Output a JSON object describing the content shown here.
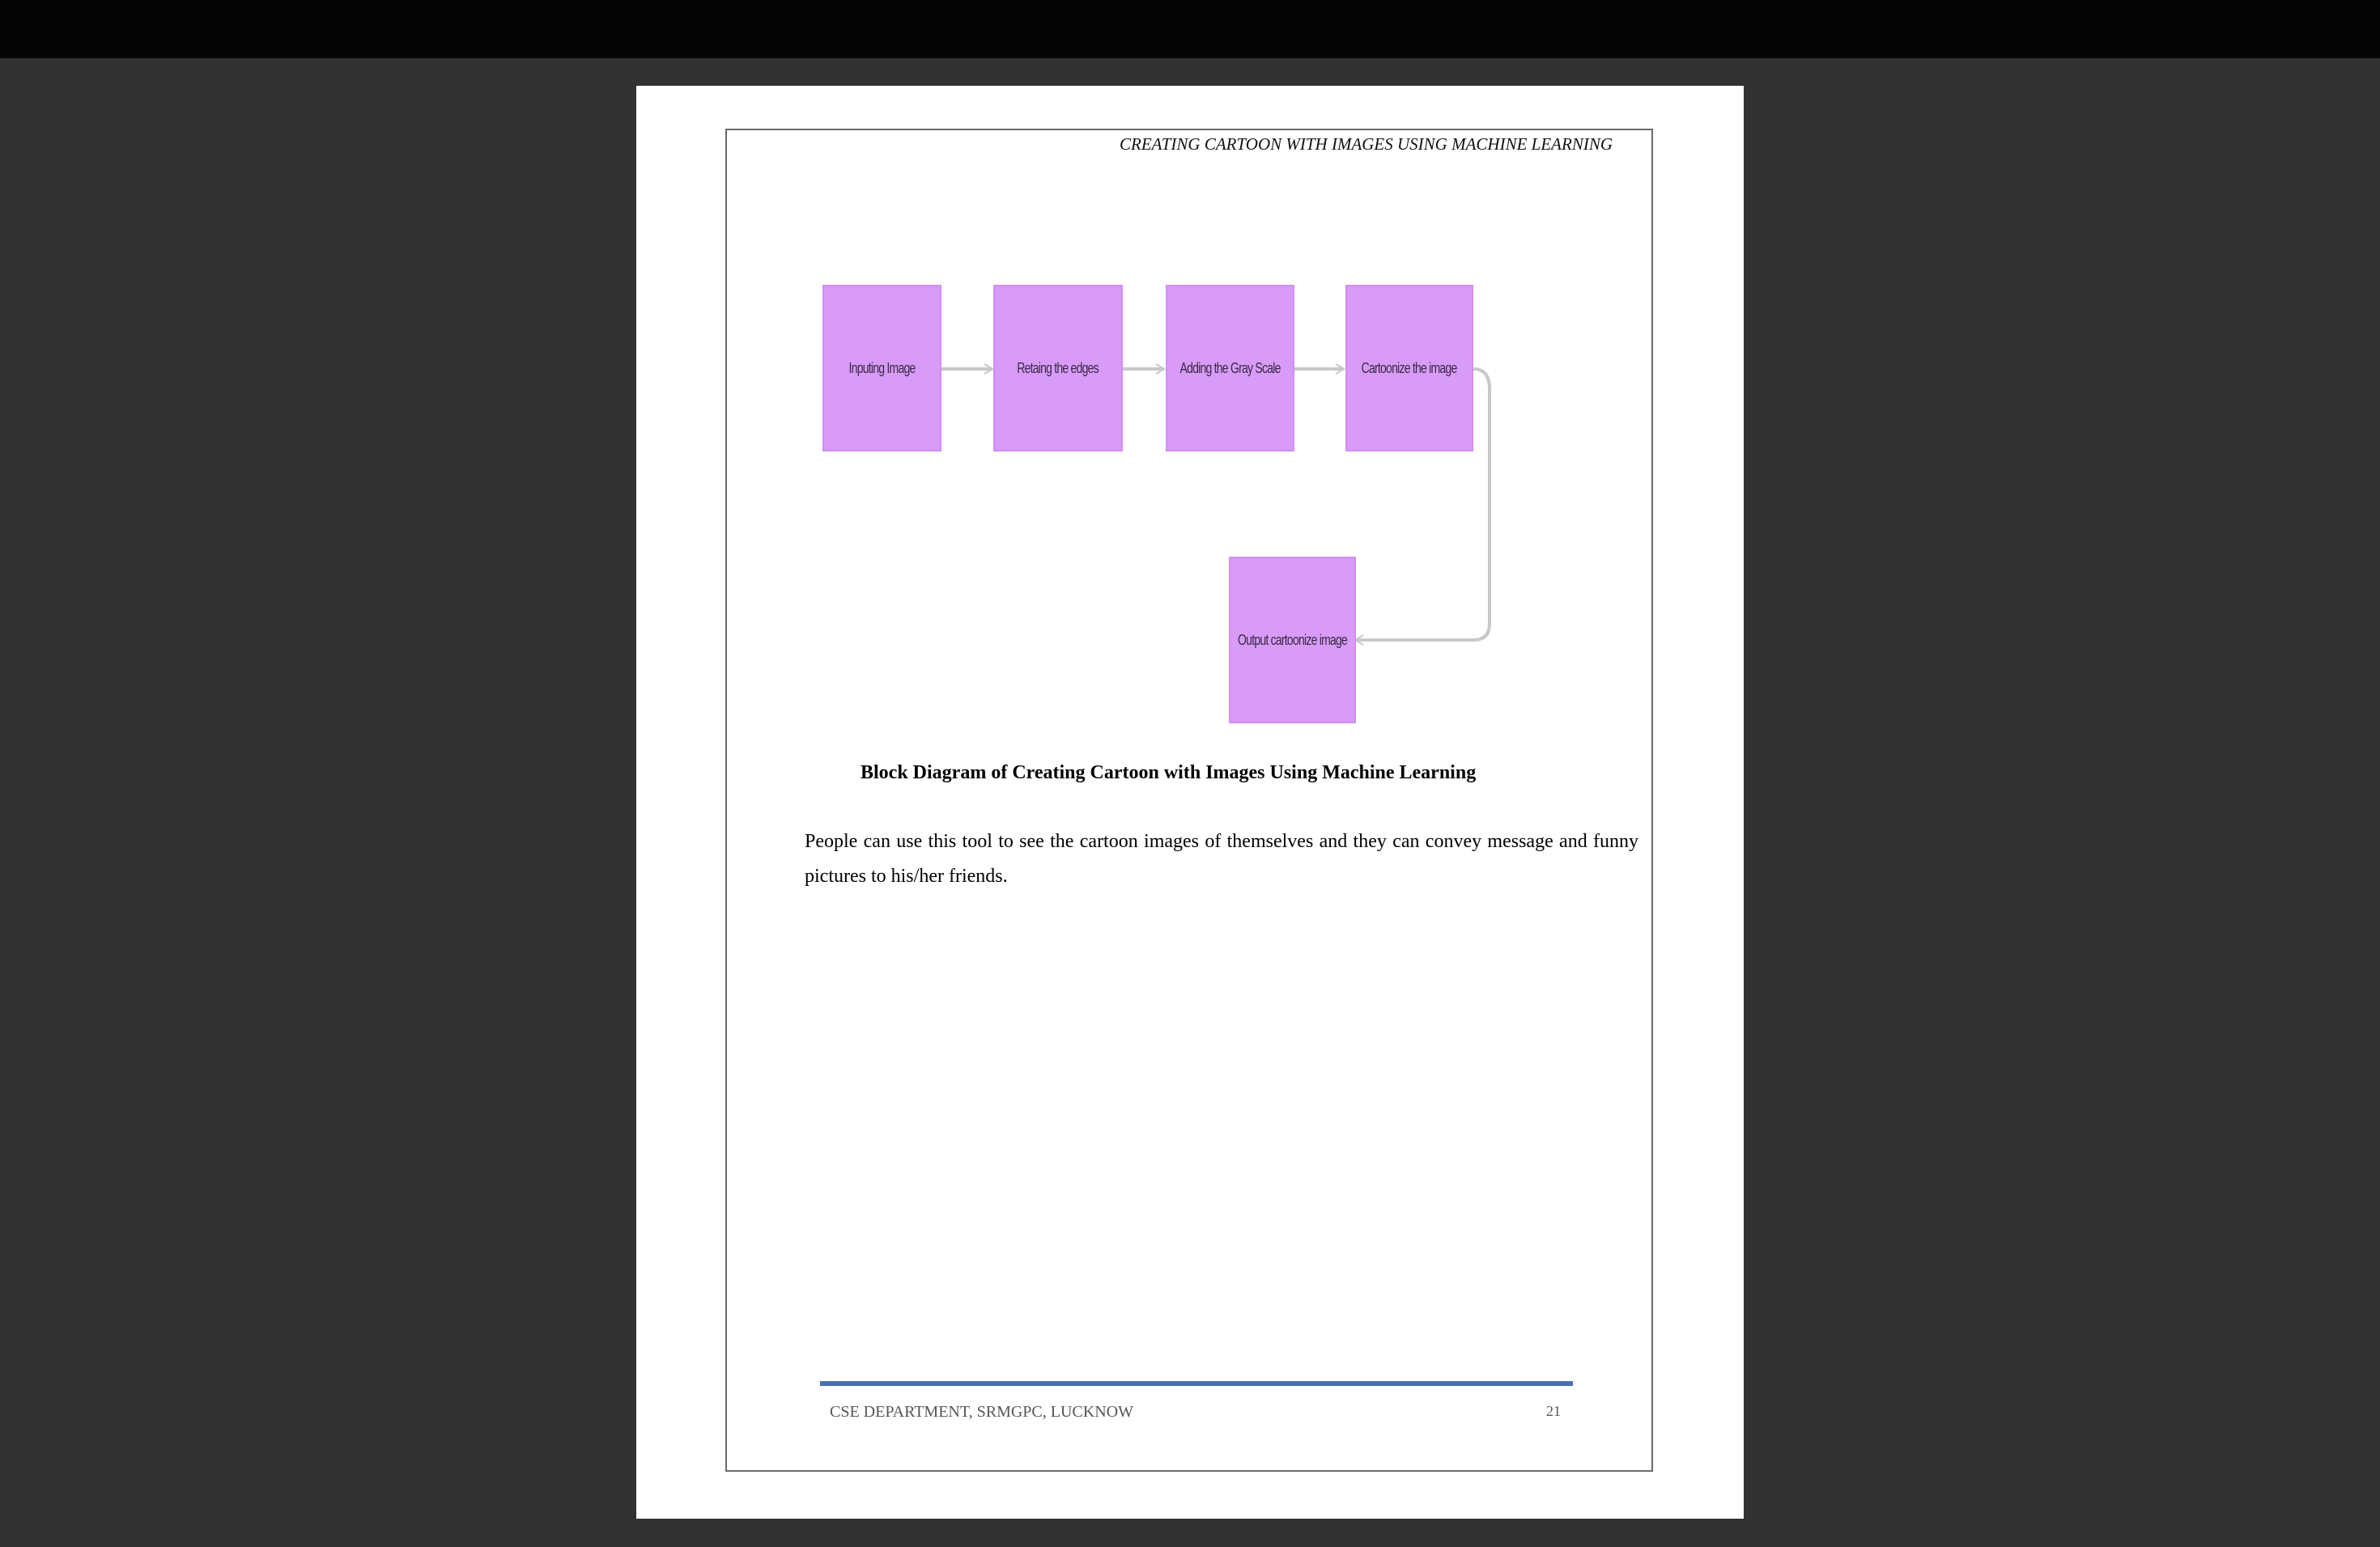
{
  "header": {
    "running_title": "CREATING CARTOON WITH IMAGES USING MACHINE LEARNING"
  },
  "diagram": {
    "nodes": [
      {
        "id": "input",
        "label": "Inputing Image"
      },
      {
        "id": "edges",
        "label": "Retaing the edges"
      },
      {
        "id": "gray",
        "label": "Adding the Gray Scale"
      },
      {
        "id": "cartoonize",
        "label": "Cartoonize the image"
      },
      {
        "id": "output",
        "label": "Output cartoonize image"
      }
    ],
    "edges": [
      {
        "from": "input",
        "to": "edges"
      },
      {
        "from": "edges",
        "to": "gray"
      },
      {
        "from": "gray",
        "to": "cartoonize"
      },
      {
        "from": "cartoonize",
        "to": "output"
      }
    ],
    "node_color": "#d89bf8",
    "connector_color": "#c8c8c8"
  },
  "caption": "Block Diagram of Creating Cartoon with Images Using Machine Learning",
  "body": {
    "paragraph": "People can use this tool to see the cartoon images of themselves and they can convey message and funny pictures to his/her friends."
  },
  "footer": {
    "department": "CSE DEPARTMENT, SRMGPC, LUCKNOW",
    "page_number": "21",
    "rule_color": "#4a6fb5"
  }
}
